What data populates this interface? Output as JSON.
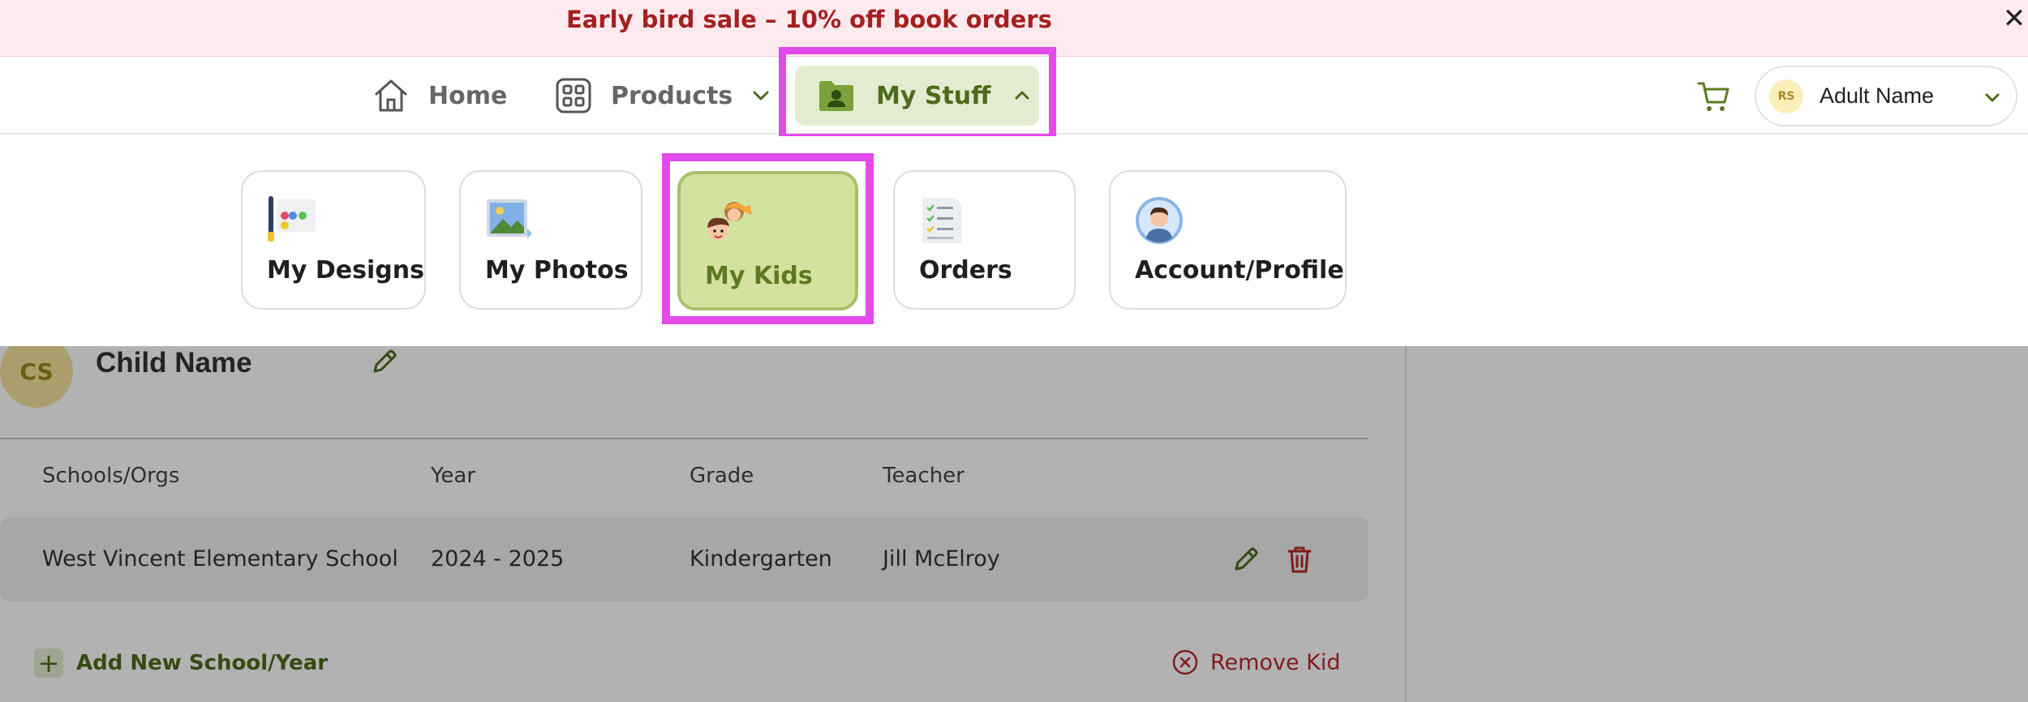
{
  "banner": {
    "text": "Early bird sale – 10% off book orders",
    "close": "✕"
  },
  "nav": {
    "home": "Home",
    "products": "Products",
    "my_stuff": "My Stuff",
    "user": {
      "initials": "RS",
      "name": "Adult Name"
    }
  },
  "menu": {
    "items": [
      {
        "label": "My Designs",
        "icon": "palette-icon"
      },
      {
        "label": "My Photos",
        "icon": "photo-icon"
      },
      {
        "label": "My Kids",
        "icon": "kids-icon",
        "selected": true
      },
      {
        "label": "Orders",
        "icon": "checklist-icon"
      },
      {
        "label": "Account/Profile",
        "icon": "profile-icon"
      }
    ]
  },
  "child": {
    "initials": "CS",
    "name": "Child Name",
    "table": {
      "headers": [
        "Schools/Orgs",
        "Year",
        "Grade",
        "Teacher"
      ],
      "rows": [
        [
          "West Vincent Elementary School",
          "2024 - 2025",
          "Kindergarten",
          "Jill McElroy"
        ]
      ]
    },
    "add_label": "Add New School/Year",
    "remove_label": "Remove Kid"
  },
  "colors": {
    "accent_green": "#4d6b1b",
    "highlight_magenta": "#e24ae9",
    "banner_text": "#a5201f",
    "danger": "#b72a2a"
  }
}
